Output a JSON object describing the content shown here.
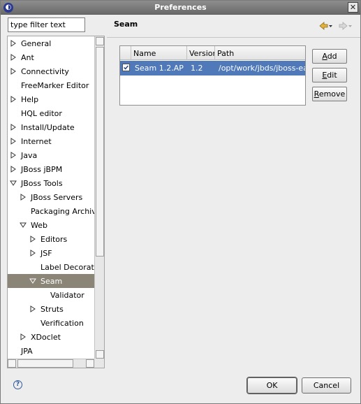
{
  "window": {
    "title": "Preferences"
  },
  "filter": {
    "placeholder": "type filter text",
    "value": "type filter text"
  },
  "tree": {
    "items": [
      {
        "label": "General",
        "twisty": "collapsed",
        "level": 0
      },
      {
        "label": "Ant",
        "twisty": "collapsed",
        "level": 0
      },
      {
        "label": "Connectivity",
        "twisty": "collapsed",
        "level": 0
      },
      {
        "label": "FreeMarker Editor",
        "twisty": "none",
        "level": 0
      },
      {
        "label": "Help",
        "twisty": "collapsed",
        "level": 0
      },
      {
        "label": "HQL editor",
        "twisty": "none",
        "level": 0
      },
      {
        "label": "Install/Update",
        "twisty": "collapsed",
        "level": 0
      },
      {
        "label": "Internet",
        "twisty": "collapsed",
        "level": 0
      },
      {
        "label": "Java",
        "twisty": "collapsed",
        "level": 0
      },
      {
        "label": "JBoss jBPM",
        "twisty": "collapsed",
        "level": 0
      },
      {
        "label": "JBoss Tools",
        "twisty": "expanded",
        "level": 0
      },
      {
        "label": "JBoss Servers",
        "twisty": "collapsed",
        "level": 1
      },
      {
        "label": "Packaging Archives",
        "twisty": "none",
        "level": 1
      },
      {
        "label": "Web",
        "twisty": "expanded",
        "level": 1
      },
      {
        "label": "Editors",
        "twisty": "collapsed",
        "level": 2
      },
      {
        "label": "JSF",
        "twisty": "collapsed",
        "level": 2
      },
      {
        "label": "Label Decorations",
        "twisty": "none",
        "level": 2
      },
      {
        "label": "Seam",
        "twisty": "expanded",
        "level": 2,
        "selected": true
      },
      {
        "label": "Validator",
        "twisty": "none",
        "level": 3
      },
      {
        "label": "Struts",
        "twisty": "collapsed",
        "level": 2
      },
      {
        "label": "Verification",
        "twisty": "none",
        "level": 2
      },
      {
        "label": "XDoclet",
        "twisty": "collapsed",
        "level": 1
      },
      {
        "label": "JPA",
        "twisty": "none",
        "level": 0
      }
    ]
  },
  "page": {
    "title": "Seam"
  },
  "runtimes": {
    "columns": [
      "Name",
      "Version",
      "Path"
    ],
    "rows": [
      {
        "checked": true,
        "name": "Seam 1.2.AP",
        "version": "1.2",
        "path": "/opt/work/jbds/jboss-eap/seam"
      }
    ]
  },
  "buttons": {
    "add": {
      "label": "Add",
      "mnemonic": "A"
    },
    "edit": {
      "label": "Edit",
      "mnemonic": "E"
    },
    "remove": {
      "label": "Remove",
      "mnemonic": "R"
    },
    "ok": "OK",
    "cancel": "Cancel"
  },
  "colors": {
    "selection": "#4f79b9",
    "tree_selection": "#8a8577",
    "nav_arrow": "#e2b33a"
  }
}
